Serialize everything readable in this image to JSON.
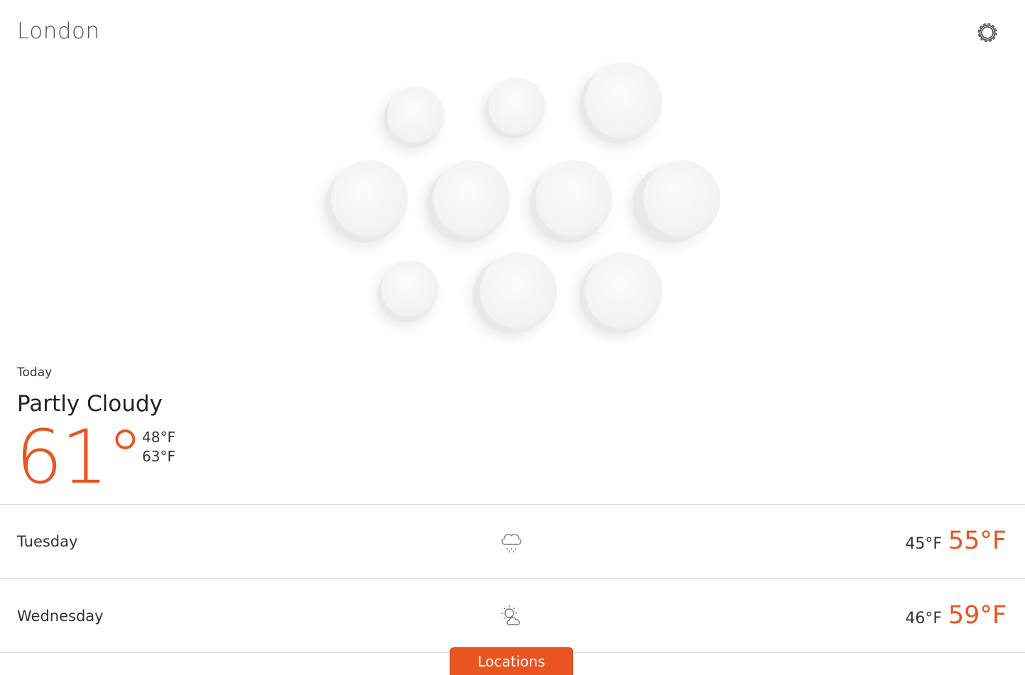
{
  "header": {
    "city": "London",
    "settings_icon": "gear-icon"
  },
  "today": {
    "label": "Today",
    "condition": "Partly Cloudy",
    "temperature": "61°",
    "low": "48°F",
    "high": "63°F"
  },
  "forecast": [
    {
      "day": "Tuesday",
      "icon": "rain-cloud-icon",
      "low": "45°F",
      "high": "55°F"
    },
    {
      "day": "Wednesday",
      "icon": "partly-cloudy-icon",
      "low": "46°F",
      "high": "59°F"
    }
  ],
  "footer": {
    "locations_label": "Locations"
  },
  "colors": {
    "accent": "#e95420",
    "text": "#333333",
    "divider": "#d9d9d9"
  }
}
